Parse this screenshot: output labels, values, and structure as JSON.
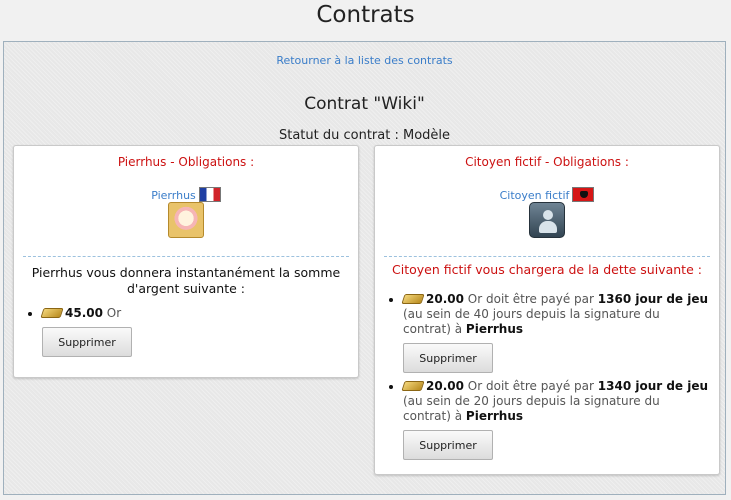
{
  "page": {
    "title": "Contrats"
  },
  "back_link": "Retourner à la liste des contrats",
  "contract": {
    "title": "Contrat \"Wiki\"",
    "status": "Statut du contrat : Modèle"
  },
  "left_panel": {
    "heading": "Pierrhus - Obligations :",
    "party_name": "Pierrhus",
    "flag_icon": "france-flag-icon",
    "description": "Pierrhus vous donnera instantanément la somme d'argent suivante :",
    "items": [
      {
        "amount": "45.00",
        "currency": "Or",
        "button": "Supprimer"
      }
    ]
  },
  "right_panel": {
    "heading": "Citoyen fictif - Obligations :",
    "party_name": "Citoyen fictif",
    "flag_icon": "albania-flag-icon",
    "description": "Citoyen fictif vous chargera de la dette suivante :",
    "items": [
      {
        "amount": "20.00",
        "text_a": "Or doit être payé par",
        "day": "1360 jour de jeu",
        "text_b": "(au sein de 40 jours depuis la signature du contrat) à",
        "recipient": "Pierrhus",
        "button": "Supprimer"
      },
      {
        "amount": "20.00",
        "text_a": "Or doit être payé par",
        "day": "1340 jour de jeu",
        "text_b": "(au sein de 20 jours depuis la signature du contrat) à",
        "recipient": "Pierrhus",
        "button": "Supprimer"
      }
    ]
  },
  "colors": {
    "heading_red": "#cc1111",
    "link_blue": "#3a7dc9"
  }
}
